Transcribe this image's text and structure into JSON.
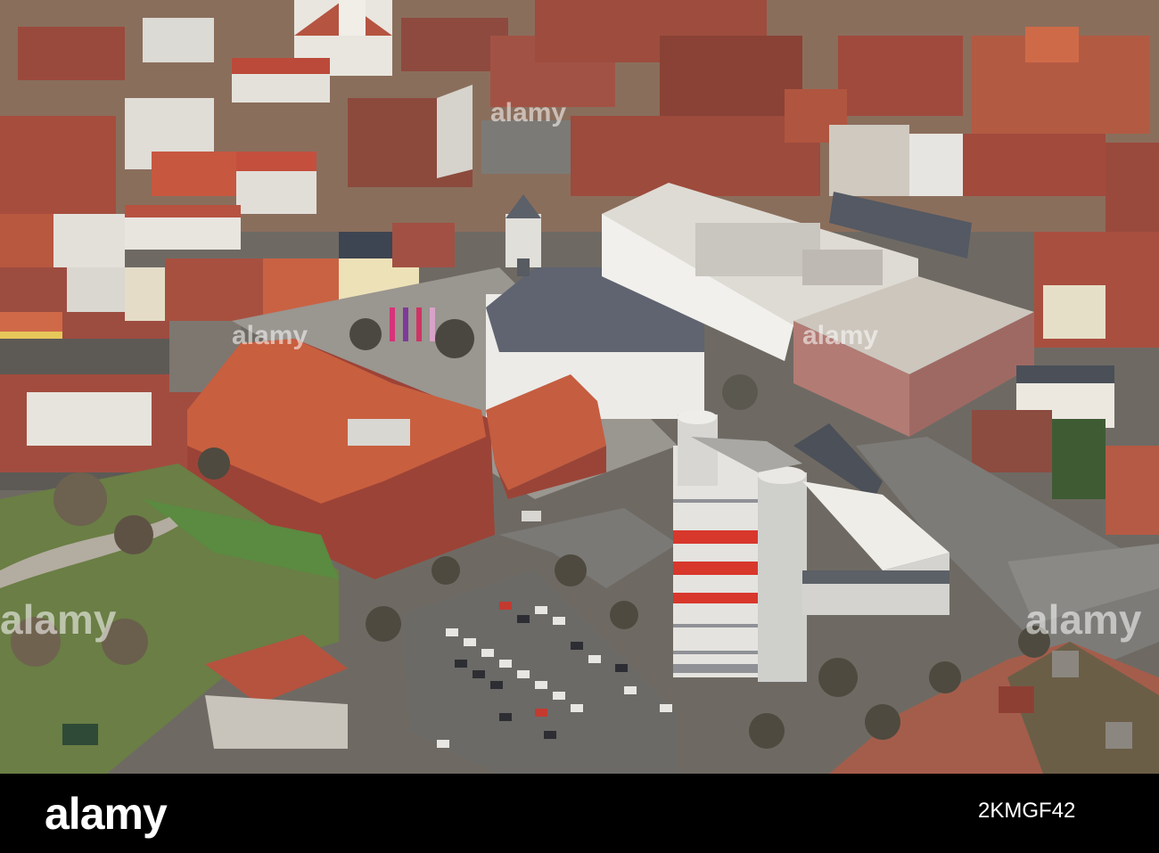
{
  "photo": {
    "description_icon": "aerial-city-photo",
    "colors": {
      "brick": "#a9503f",
      "roof_orange": "#c8603f",
      "grass": "#6f8d4a",
      "asphalt": "#7d7d7b",
      "white_building": "#e6e4df",
      "accent_red": "#d8372c"
    }
  },
  "watermarks": [
    "alamy",
    "alamy",
    "alamy",
    "alamy",
    "alamy"
  ],
  "footer": {
    "logo": "alamy",
    "image_id": "2KMGF42"
  }
}
